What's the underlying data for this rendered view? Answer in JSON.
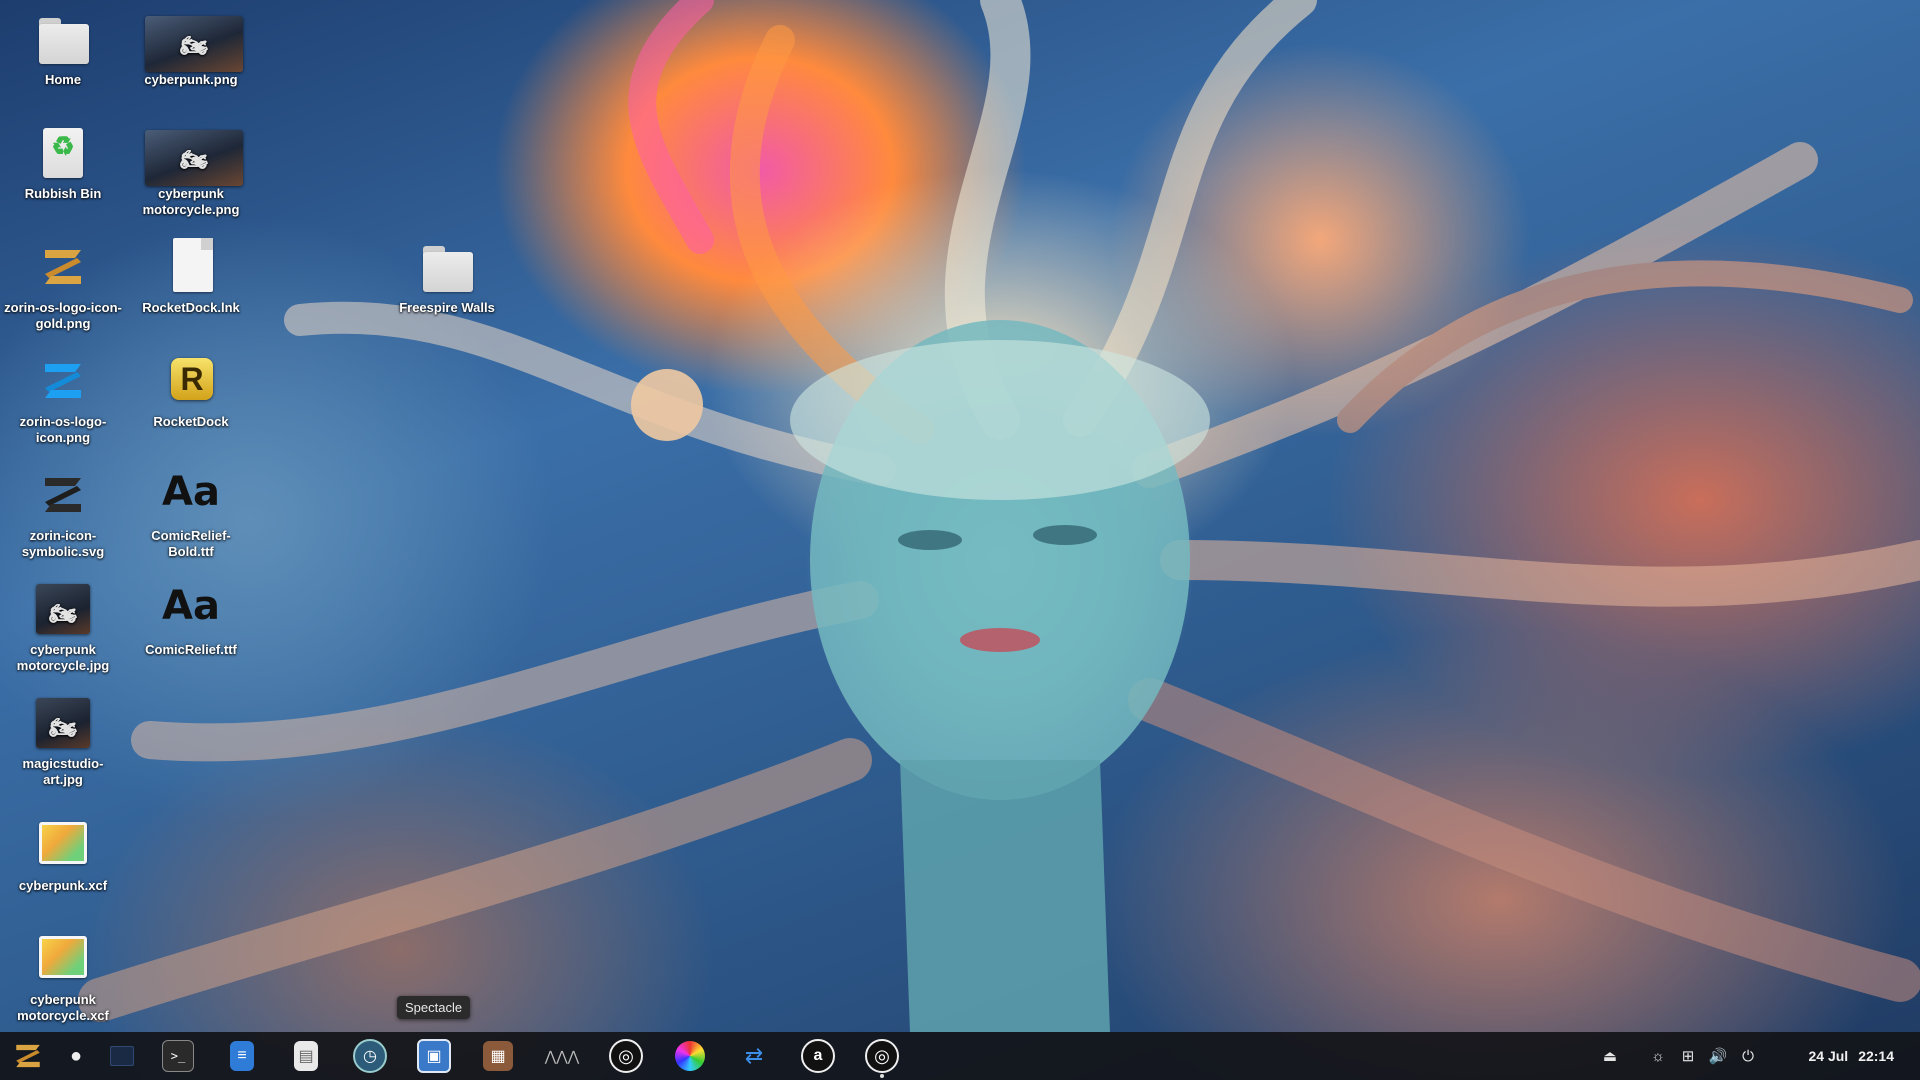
{
  "desktop": {
    "icons": [
      {
        "label": "Home",
        "icon": "home-folder-icon"
      },
      {
        "label": "cyberpunk.png",
        "icon": "image-thumbnail-icon"
      },
      {
        "label": "Rubbish Bin",
        "icon": "recycle-bin-icon"
      },
      {
        "label": "cyberpunk motorcycle.png",
        "icon": "image-thumbnail-icon"
      },
      {
        "label": "zorin-os-logo-icon-gold.png",
        "icon": "zorin-logo-icon"
      },
      {
        "label": "RocketDock.lnk",
        "icon": "document-icon"
      },
      {
        "label": "Freespire Walls",
        "icon": "folder-icon"
      },
      {
        "label": "zorin-os-logo-icon.png",
        "icon": "zorin-logo-icon"
      },
      {
        "label": "RocketDock",
        "icon": "rocketdock-icon"
      },
      {
        "label": "zorin-icon-symbolic.svg",
        "icon": "zorin-logo-icon"
      },
      {
        "label": "ComicRelief-Bold.ttf",
        "icon": "font-icon",
        "glyph": "Aa"
      },
      {
        "label": "cyberpunk motorcycle.jpg",
        "icon": "image-thumbnail-icon"
      },
      {
        "label": "ComicRelief.ttf",
        "icon": "font-icon",
        "glyph": "Aa"
      },
      {
        "label": "magicstudio-art.jpg",
        "icon": "image-thumbnail-icon"
      },
      {
        "label": "cyberpunk.xcf",
        "icon": "gimp-image-icon"
      },
      {
        "label": "cyberpunk motorcycle.xcf",
        "icon": "gimp-image-icon"
      }
    ]
  },
  "tooltip": {
    "text": "Spectacle"
  },
  "taskbar": {
    "apps": [
      {
        "name": "zorin-menu-icon"
      },
      {
        "name": "apple-icon"
      },
      {
        "name": "show-desktop-icon"
      },
      {
        "name": "terminal-icon"
      },
      {
        "name": "notes-app-icon"
      },
      {
        "name": "document-viewer-icon"
      },
      {
        "name": "system-monitor-icon"
      },
      {
        "name": "spectacle-screenshot-icon"
      },
      {
        "name": "package-manager-icon"
      },
      {
        "name": "equalizer-icon"
      },
      {
        "name": "target-app-icon"
      },
      {
        "name": "color-wheel-icon"
      },
      {
        "name": "kde-connect-icon"
      },
      {
        "name": "audacity-icon"
      },
      {
        "name": "target-app-2-icon"
      }
    ],
    "tray": [
      {
        "name": "eject-icon"
      },
      {
        "name": "brightness-icon"
      },
      {
        "name": "network-icon"
      },
      {
        "name": "volume-icon"
      },
      {
        "name": "power-icon"
      }
    ],
    "date": "24 Jul",
    "time": "22:14"
  },
  "colors": {
    "taskbar_bg": "#121418",
    "label_text": "#ffffff",
    "tooltip_bg": "#2b2b2b"
  }
}
